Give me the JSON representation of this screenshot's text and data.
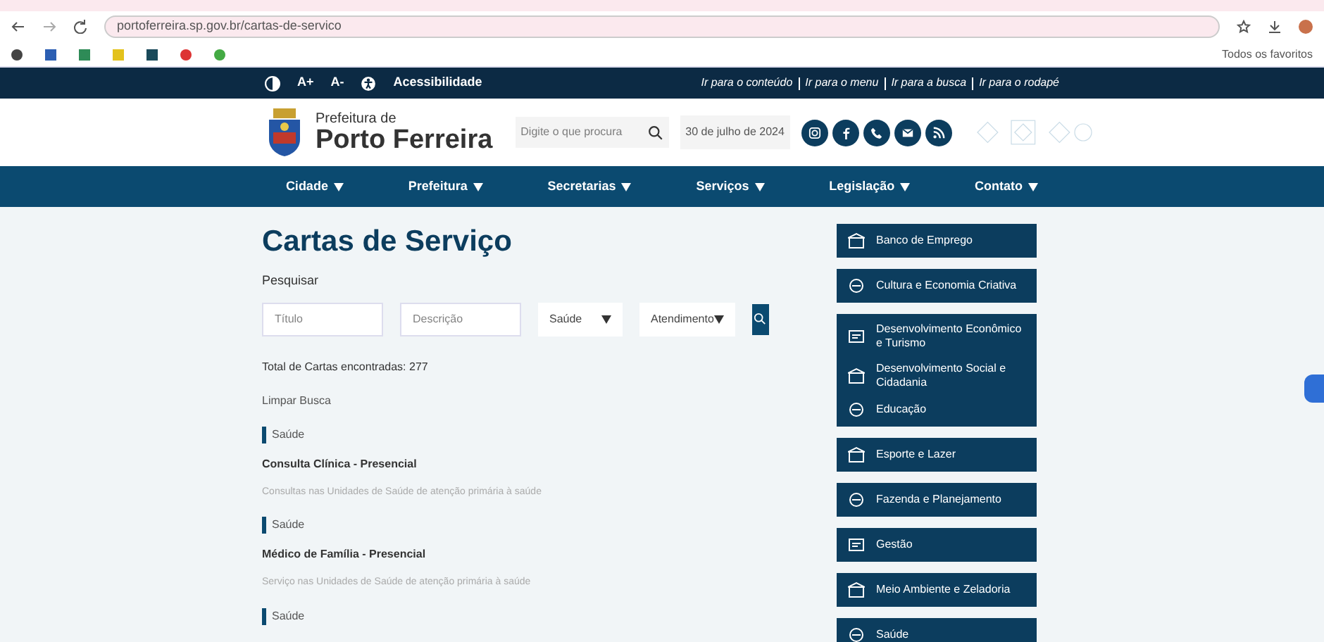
{
  "browser": {
    "url": "portoferreira.sp.gov.br/cartas-de-servico",
    "bookmarks_folder": "Todos os favoritos"
  },
  "accessibility_bar": {
    "font_up": "A+",
    "font_down": "A-",
    "accessibility": "Acessibilidade",
    "skip_links": [
      "Ir para o conteúdo",
      "Ir para o menu",
      "Ir para a busca",
      "Ir para o rodapé"
    ]
  },
  "header": {
    "logo_small": "Prefeitura de",
    "logo_big": "Porto Ferreira",
    "search": {
      "placeholder": "Digite o que procura"
    },
    "date": "30 de julho de 2024"
  },
  "nav": [
    "Cidade",
    "Prefeitura",
    "Secretarias",
    "Serviços",
    "Legislação",
    "Contato"
  ],
  "main": {
    "title": "Cartas de Serviço",
    "search_label": "Pesquisar",
    "fields": [
      {
        "kind": "input",
        "placeholder": "Título"
      },
      {
        "kind": "input",
        "placeholder": "Descrição"
      },
      {
        "kind": "select",
        "value": "Saúde"
      },
      {
        "kind": "select",
        "value": "Atendimento"
      }
    ],
    "total": "Total de Cartas encontradas: 277",
    "clear": "Limpar Busca",
    "results": [
      {
        "tag": "Saúde",
        "title": "Consulta Clínica - Presencial",
        "description": "Consultas nas Unidades de Saúde de atenção primária à saúde"
      },
      {
        "tag": "Saúde",
        "title": "Médico de Família - Presencial",
        "description": "Serviço nas Unidades de Saúde de atenção primária à saúde"
      },
      {
        "tag": "Saúde"
      }
    ]
  },
  "sidebar": [
    {
      "items": [
        "Banco de Emprego"
      ]
    },
    {
      "items": [
        "Cultura e Economia Criativa"
      ]
    },
    {
      "items": [
        "Desenvolvimento Econômico e Turismo",
        "Desenvolvimento Social e Cidadania",
        "Educação"
      ]
    },
    {
      "items": [
        "Esporte e Lazer"
      ]
    },
    {
      "items": [
        "Fazenda e Planejamento"
      ]
    },
    {
      "items": [
        "Gestão"
      ]
    },
    {
      "items": [
        "Meio Ambiente e Zeladoria"
      ]
    },
    {
      "items": [
        "Saúde"
      ]
    }
  ]
}
